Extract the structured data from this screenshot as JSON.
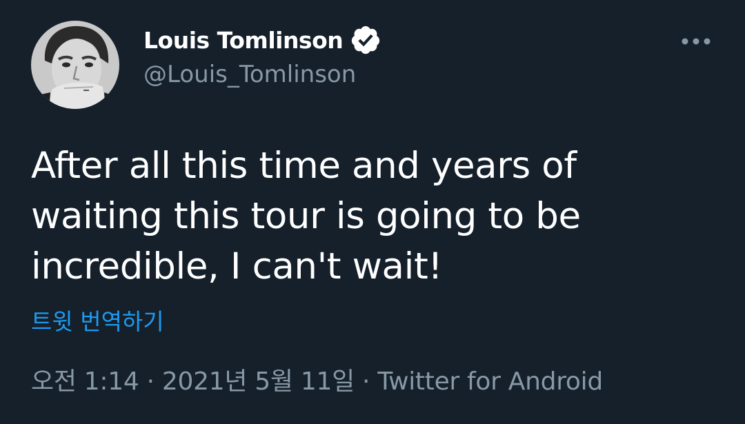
{
  "tweet": {
    "author": {
      "display_name": "Louis Tomlinson",
      "handle": "@Louis_Tomlinson",
      "verified": true,
      "avatar_icon": "user-avatar"
    },
    "more_icon": "more-horizontal-icon",
    "text_lines": [
      "After all this time and years of",
      "waiting this tour is going to be",
      "incredible, I can't wait!"
    ],
    "translate_label": "트윗 번역하기",
    "meta": {
      "time": "오전 1:14",
      "separator": "·",
      "date": "2021년 5월 11일",
      "source": "Twitter for Android"
    }
  },
  "colors": {
    "background": "#15202b",
    "primary_text": "#ffffff",
    "secondary_text": "#8899a6",
    "link": "#1d9bf0"
  }
}
